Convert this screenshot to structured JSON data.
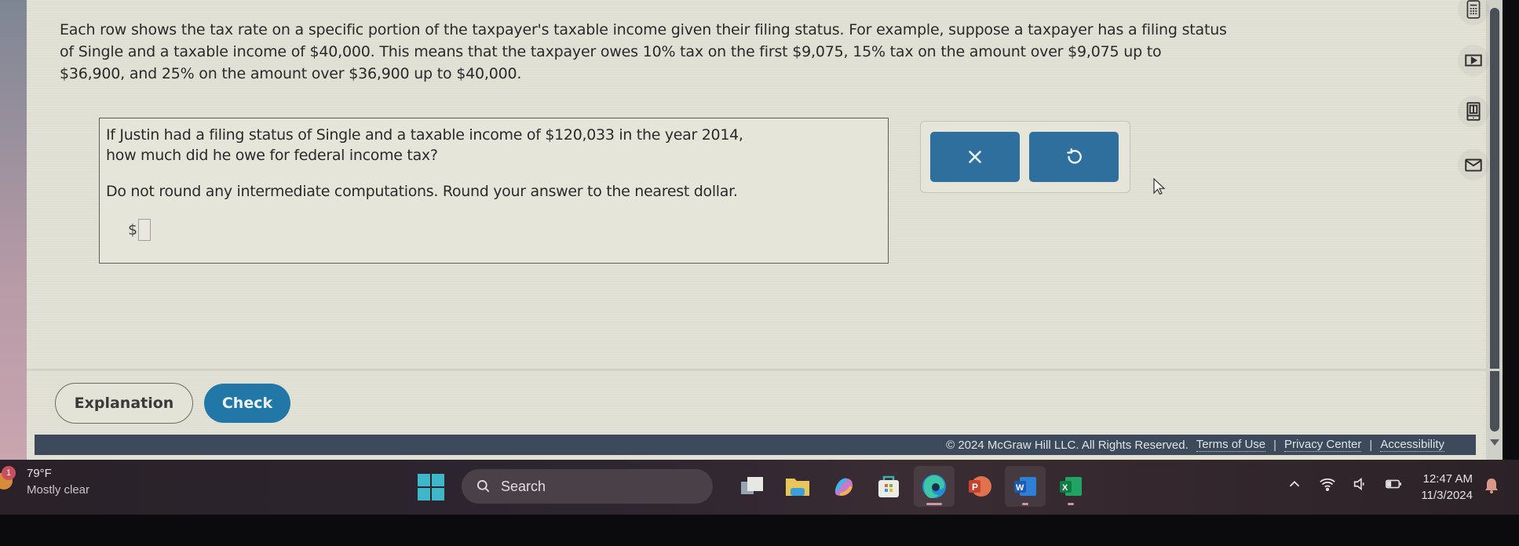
{
  "intro": {
    "line1": "Each row shows the tax rate on a specific portion of the taxpayer's taxable income given their filing status. For example, suppose a taxpayer has a filing status",
    "line2": "of Single and a taxable income of $40,000. This means that the taxpayer owes 10% tax on the first $9,075, 15% tax on the amount over $9,075 up to",
    "line3": "$36,900, and 25% on the amount over $36,900 up to $40,000."
  },
  "question": {
    "line1": "If Justin had a filing status of Single and a taxable income of $120,033 in the year 2014,",
    "line2": "how much did he owe for federal income tax?",
    "instruction": "Do not round any intermediate computations. Round your answer to the nearest dollar.",
    "currency_symbol": "$",
    "answer_value": ""
  },
  "actions": {
    "clear_icon": "x-icon",
    "undo_icon": "undo-icon"
  },
  "side_tools": [
    "calculator-icon",
    "video-icon",
    "ebook-icon",
    "message-icon"
  ],
  "buttons": {
    "explanation": "Explanation",
    "check": "Check"
  },
  "footer": {
    "copyright": "© 2024 McGraw Hill LLC. All Rights Reserved.",
    "links": [
      "Terms of Use",
      "Privacy Center",
      "Accessibility"
    ],
    "separator": "|"
  },
  "taskbar": {
    "weather": {
      "badge": "1",
      "temperature": "79°F",
      "condition": "Mostly clear"
    },
    "search_label": "Search",
    "apps": [
      {
        "name": "Task View",
        "active": false
      },
      {
        "name": "File Explorer",
        "active": false
      },
      {
        "name": "Copilot",
        "active": false
      },
      {
        "name": "Microsoft Store",
        "active": false
      },
      {
        "name": "Microsoft Edge",
        "active": true
      },
      {
        "name": "PowerPoint",
        "active": false
      },
      {
        "name": "Word",
        "active": true
      },
      {
        "name": "Excel",
        "active": false
      }
    ],
    "tray": {
      "time": "12:47 AM",
      "date": "11/3/2024"
    }
  }
}
